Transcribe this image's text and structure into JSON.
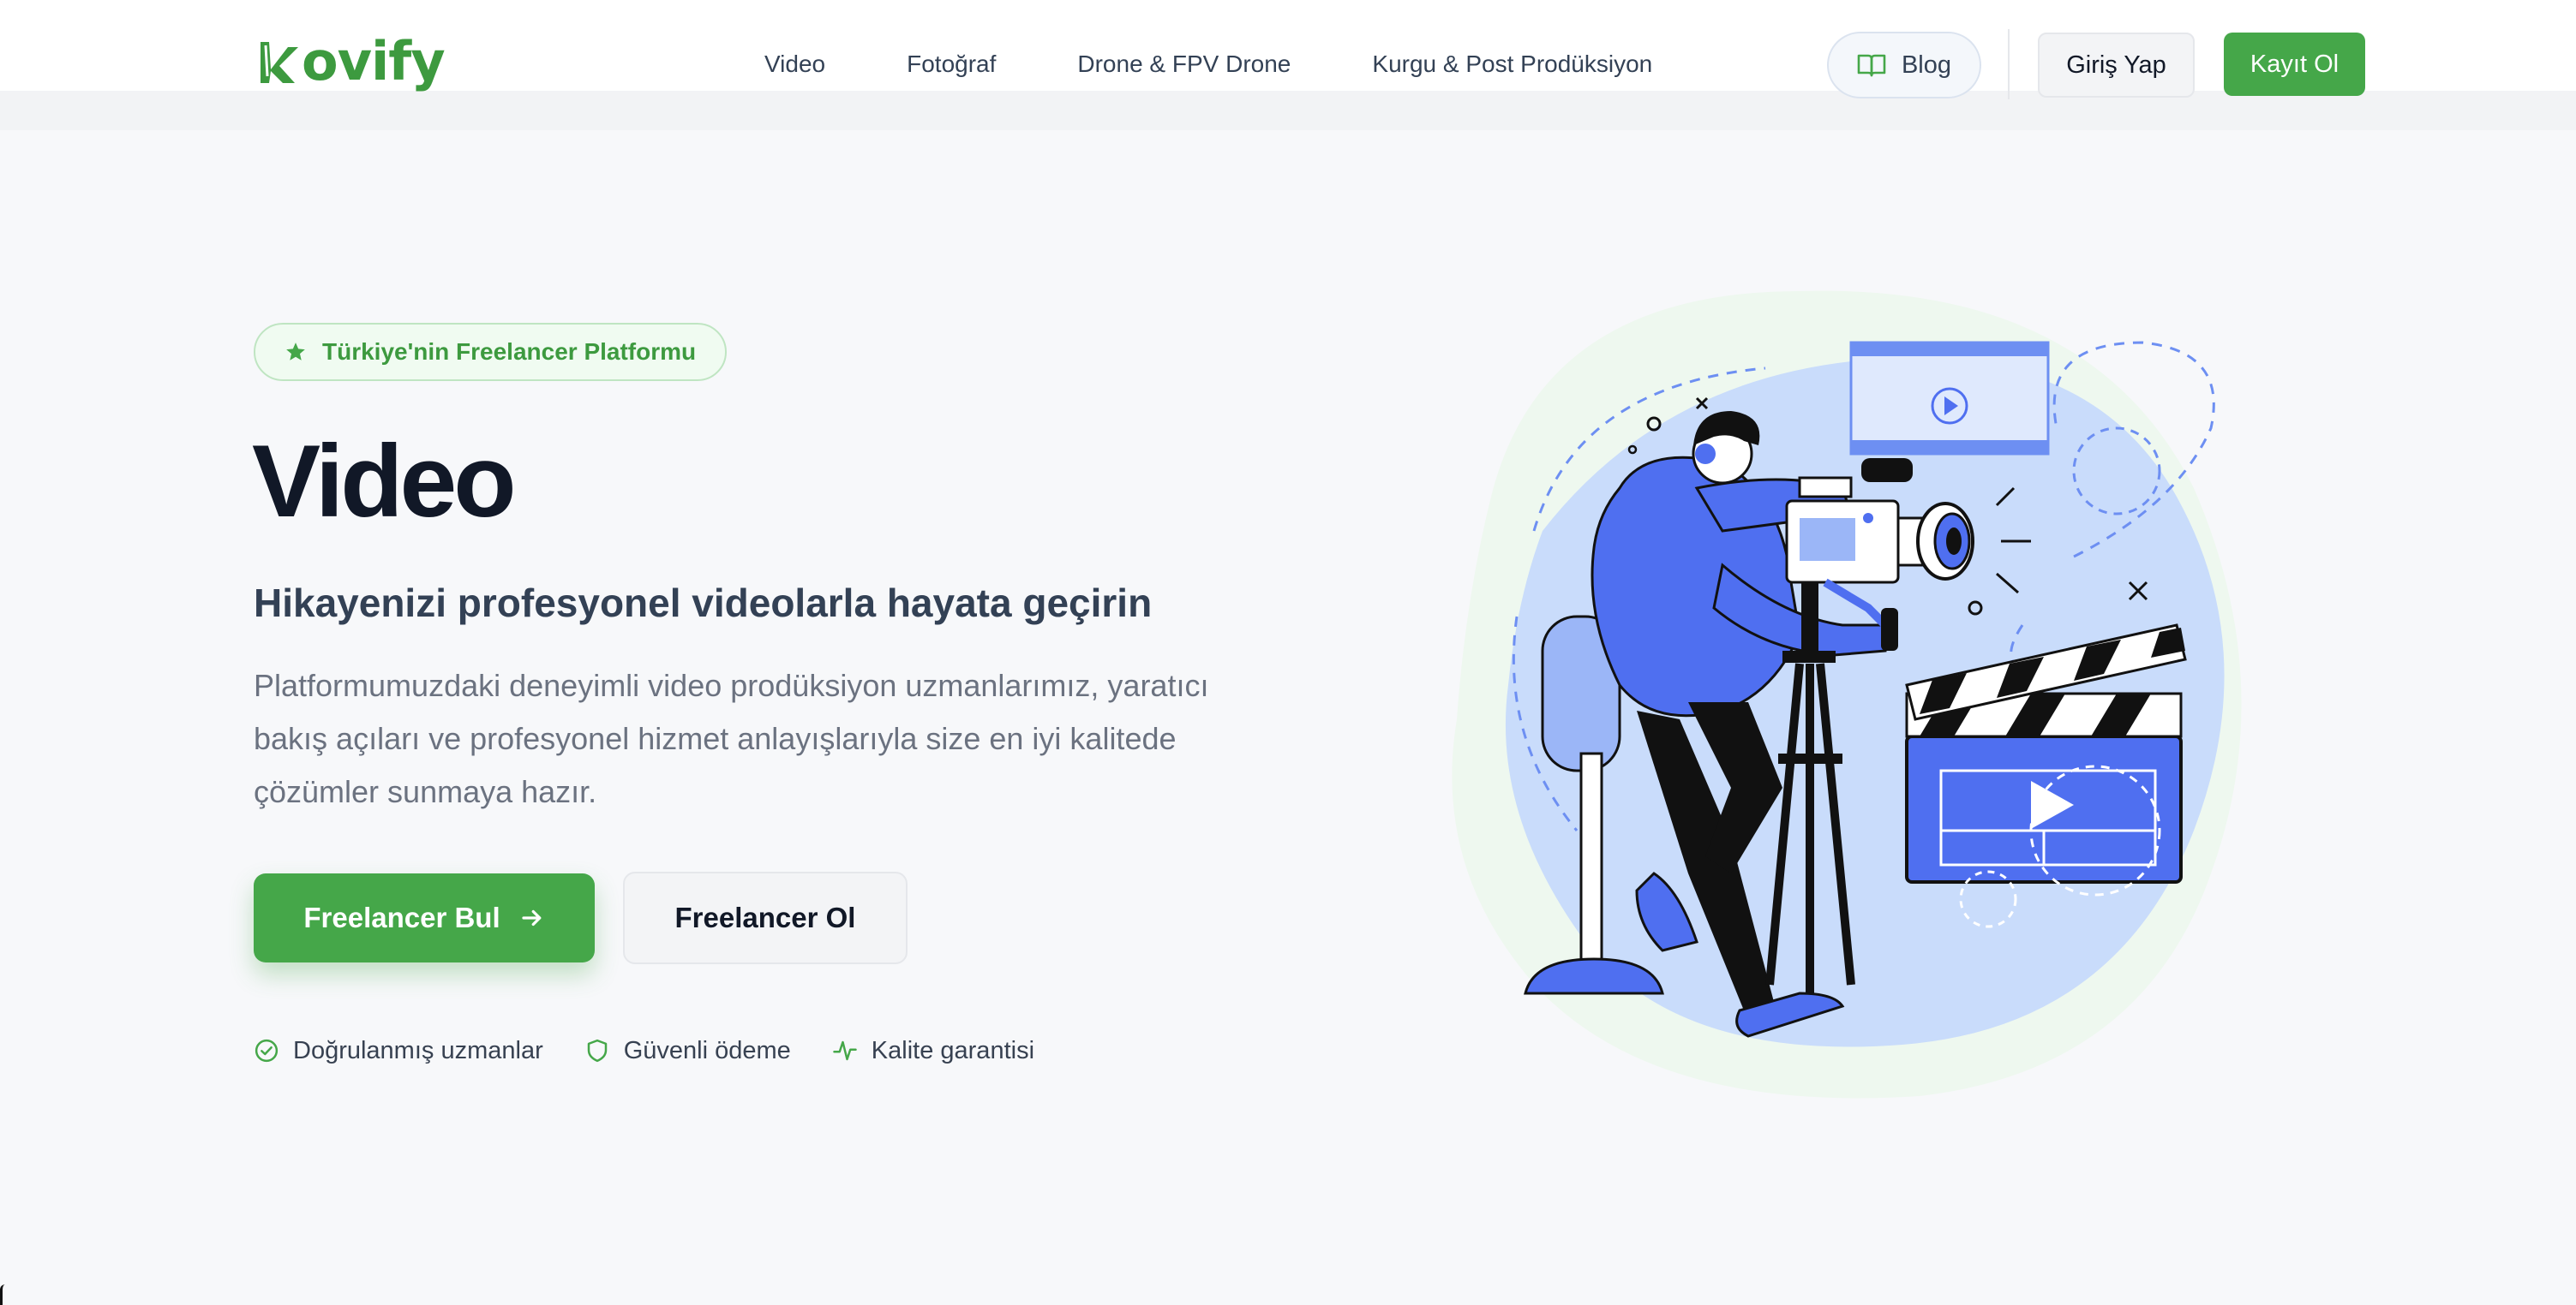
{
  "brand": {
    "name": "ovify",
    "color": "#3d9a3f"
  },
  "nav": {
    "items": [
      {
        "label": "Video"
      },
      {
        "label": "Fotoğraf"
      },
      {
        "label": "Drone & FPV Drone"
      },
      {
        "label": "Kurgu & Post Prodüksiyon"
      }
    ],
    "blog_label": "Blog",
    "blog_icon": "book-open-icon",
    "login_label": "Giriş Yap",
    "signup_label": "Kayıt Ol"
  },
  "hero": {
    "badge_label": "Türkiye'nin Freelancer Platformu",
    "badge_icon": "star-icon",
    "title": "Video",
    "subtitle": "Hikayenizi profesyonel videolarla hayata geçirin",
    "description": "Platformumuzdaki deneyimli video prodüksiyon uzmanlarımız, yaratıcı bakış açıları ve profesyonel hizmet anlayışlarıyla size en iyi kalitede çözümler sunmaya hazır.",
    "primary_cta": "Freelancer Bul",
    "primary_cta_icon": "arrow-right-icon",
    "secondary_cta": "Freelancer Ol",
    "features": [
      {
        "label": "Doğrulanmış uzmanlar",
        "icon": "check-circle-icon"
      },
      {
        "label": "Güvenli ödeme",
        "icon": "shield-icon"
      },
      {
        "label": "Kalite garantisi",
        "icon": "activity-icon"
      }
    ]
  },
  "colors": {
    "accent": "#45a749",
    "illustration_blue": "#4f6ff0",
    "illustration_bg": "#c9dcfb"
  }
}
